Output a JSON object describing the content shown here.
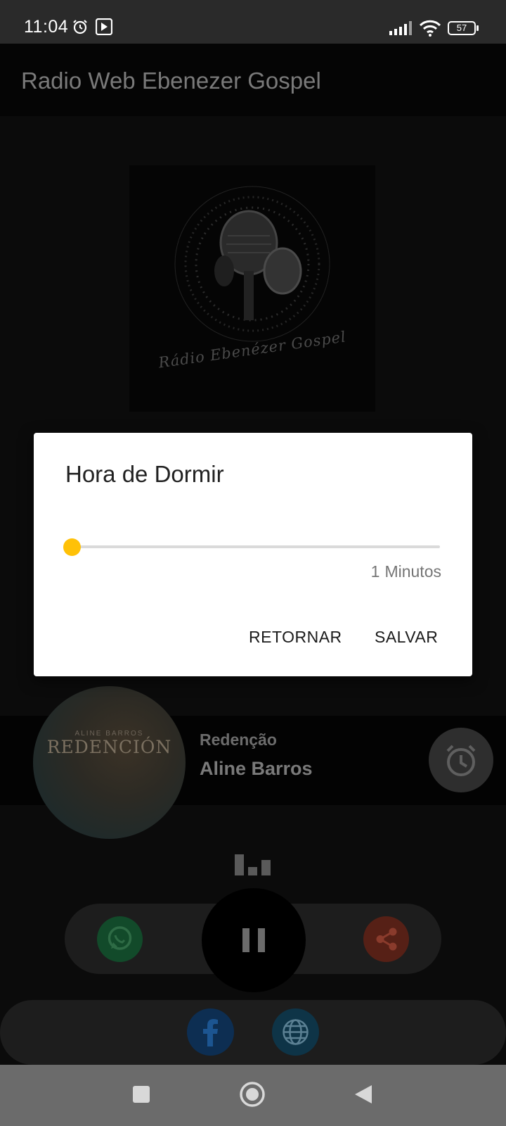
{
  "status_bar": {
    "time": "11:04",
    "battery": "57"
  },
  "app_bar": {
    "title": "Radio Web Ebenezer Gospel"
  },
  "logo": {
    "text": "Rádio Ebenézer Gospel"
  },
  "now_playing": {
    "song": "Redenção",
    "artist": "Aline Barros",
    "album_art": {
      "artist_text": "ALINE BARROS",
      "title_text": "REDENCIÓN"
    }
  },
  "dialog": {
    "title": "Hora de Dormir",
    "slider": {
      "value": 1,
      "min": 0,
      "max": 120,
      "unit": "Minutos",
      "accent": "#ffc107"
    },
    "return_label": "RETORNAR",
    "save_label": "SALVAR"
  },
  "controls": {
    "whatsapp_icon": "whatsapp-icon",
    "pause_icon": "pause-icon",
    "share_icon": "share-icon",
    "alarm_icon": "alarm-clock-icon",
    "equalizer_icon": "equalizer-icon"
  },
  "social": {
    "facebook_icon": "facebook-icon",
    "globe_icon": "globe-icon"
  },
  "nav": {
    "recents": "square-icon",
    "home": "circle-icon",
    "back": "triangle-back-icon"
  }
}
